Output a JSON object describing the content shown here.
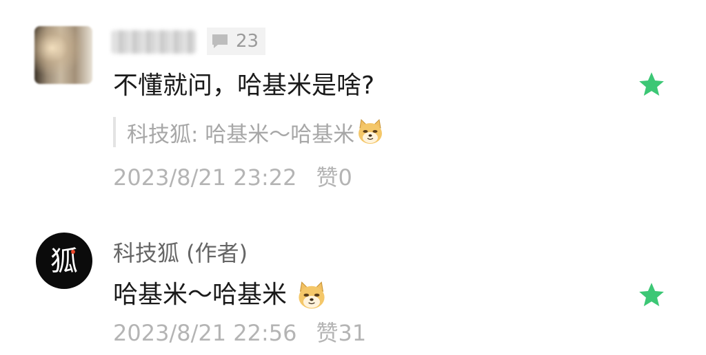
{
  "comments": [
    {
      "reply_count": "23",
      "text": "不懂就问，哈基米是啥?",
      "quote": "科技狐: 哈基米～哈基米",
      "timestamp": "2023/8/21 23:22",
      "likes": "赞0"
    },
    {
      "author": "科技狐 (作者)",
      "avatar_text": "狐",
      "text": "哈基米～哈基米",
      "timestamp": "2023/8/21 22:56",
      "likes": "赞31"
    }
  ],
  "icons": {
    "reply": "speech-bubble-icon",
    "star": "star-icon",
    "emoji": "doge-emoji"
  },
  "colors": {
    "star": "#3cc775",
    "meta_text": "#b4b4b4",
    "body_text": "#1a1a1a"
  }
}
